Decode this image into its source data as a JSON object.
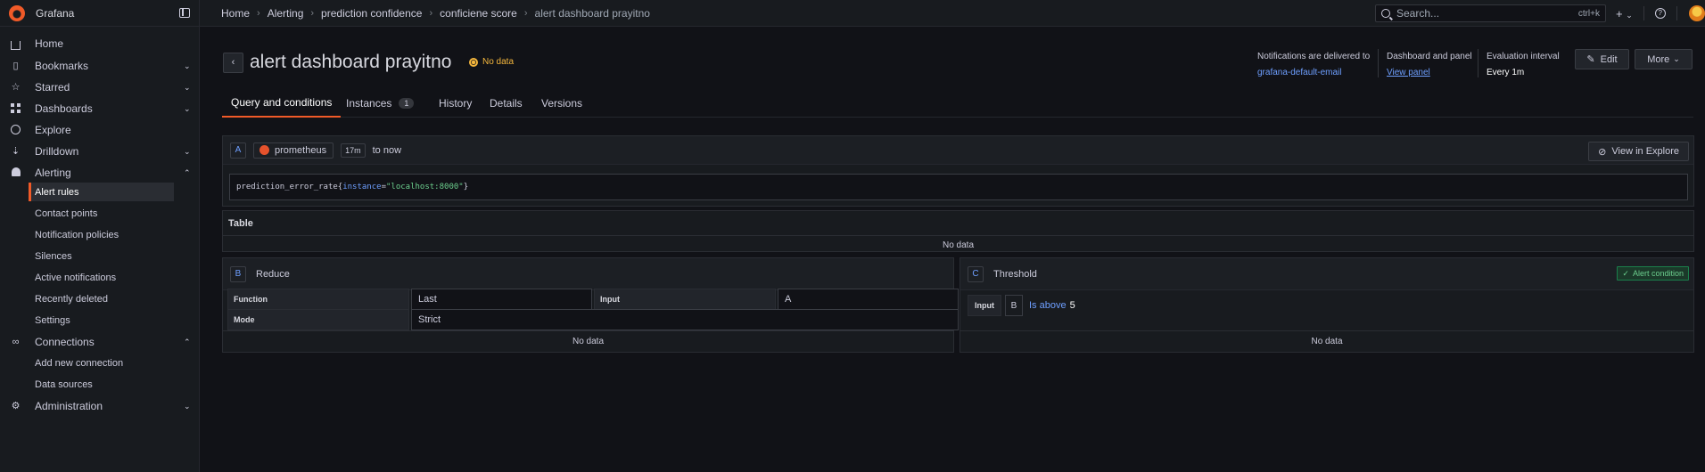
{
  "app": {
    "name": "Grafana"
  },
  "breadcrumbs": [
    "Home",
    "Alerting",
    "prediction confidence",
    "conficiene score",
    "alert dashboard prayitno"
  ],
  "search": {
    "placeholder": "Search...",
    "shortcut": "ctrl+k"
  },
  "topbar": {
    "add_icon": "+",
    "add_chevron": "⌄",
    "help_icon": "?"
  },
  "sidebar": {
    "items": [
      {
        "label": "Home",
        "icon": "home-icon"
      },
      {
        "label": "Bookmarks",
        "icon": "bookmark-icon",
        "chevron": "⌄"
      },
      {
        "label": "Starred",
        "icon": "star-icon",
        "chevron": "⌄"
      },
      {
        "label": "Dashboards",
        "icon": "apps-icon",
        "chevron": "⌄"
      },
      {
        "label": "Explore",
        "icon": "compass-icon"
      },
      {
        "label": "Drilldown",
        "icon": "drilldown-icon",
        "chevron": "⌄"
      },
      {
        "label": "Alerting",
        "icon": "bell-icon",
        "chevron": "⌃"
      },
      {
        "label": "Connections",
        "icon": "link-icon",
        "chevron": "⌃"
      },
      {
        "label": "Administration",
        "icon": "cog-icon",
        "chevron": "⌄"
      }
    ],
    "alerting_sub": [
      "Alert rules",
      "Contact points",
      "Notification policies",
      "Silences",
      "Active notifications",
      "Recently deleted",
      "Settings"
    ],
    "connections_sub": [
      "Add new connection",
      "Data sources"
    ]
  },
  "page": {
    "title": "alert dashboard prayitno",
    "state": "No data",
    "back_icon": "‹",
    "meta": {
      "notifications_label": "Notifications are delivered to",
      "notifications_value": "grafana-default-email",
      "dashboard_label": "Dashboard and panel",
      "dashboard_value": "View panel",
      "interval_label": "Evaluation interval",
      "interval_value": "Every 1m"
    },
    "edit_label": "Edit",
    "more_label": "More"
  },
  "tabs": [
    {
      "label": "Query and conditions",
      "active": true
    },
    {
      "label": "Instances",
      "count": "1"
    },
    {
      "label": "History"
    },
    {
      "label": "Details"
    },
    {
      "label": "Versions"
    }
  ],
  "query": {
    "ref_id": "A",
    "datasource": "prometheus",
    "range": "17m",
    "range_suffix": "to now",
    "explore_label": "View in Explore",
    "expr_metric": "prediction_error_rate",
    "expr_open": "{",
    "expr_label": "instance",
    "expr_eq": "=",
    "expr_value": "\"localhost:8000\"",
    "expr_close": "}"
  },
  "table": {
    "title": "Table",
    "empty": "No data"
  },
  "reduce": {
    "ref_id": "B",
    "title": "Reduce",
    "function_label": "Function",
    "function_value": "Last",
    "input_label": "Input",
    "input_value": "A",
    "mode_label": "Mode",
    "mode_value": "Strict",
    "empty": "No data"
  },
  "threshold": {
    "ref_id": "C",
    "title": "Threshold",
    "badge": "Alert condition",
    "badge_icon": "✓",
    "input_label": "Input",
    "input_value": "B",
    "operator": "Is above",
    "value": "5",
    "empty": "No data"
  }
}
